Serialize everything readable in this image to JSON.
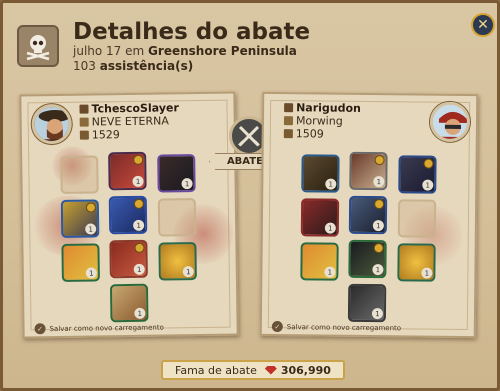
{
  "header": {
    "title": "Detalhes do abate",
    "date": "julho 17",
    "location_prefix": "em",
    "location": "Greenshore Peninsula",
    "assist_count": "103",
    "assist_label": "assistência(s)",
    "icon": "skull-crossbones-icon"
  },
  "close_icon": "close-icon",
  "versus": {
    "label": "ABATEU",
    "icon": "crossed-swords-icon"
  },
  "killer": {
    "name": "TchescoSlayer",
    "guild": "NEVE ETERNA",
    "item_power": "1529",
    "save_label": "Salvar como novo carregamento",
    "equipment": [
      {
        "slot": "head",
        "qty": "1"
      },
      {
        "slot": "bag",
        "qty": "1"
      },
      {
        "slot": "main-hand",
        "qty": "1"
      },
      {
        "slot": "armor",
        "qty": "1"
      },
      {
        "slot": "off-hand",
        "qty": ""
      },
      {
        "slot": "potion",
        "qty": "1"
      },
      {
        "slot": "shoes",
        "qty": "1"
      },
      {
        "slot": "food",
        "qty": "1"
      },
      {
        "slot": "mount",
        "qty": "1"
      }
    ]
  },
  "victim": {
    "name": "Narigudon",
    "guild": "Morwing",
    "item_power": "1509",
    "save_label": "Salvar como novo carregamento",
    "equipment": [
      {
        "slot": "bag",
        "qty": "1"
      },
      {
        "slot": "head",
        "qty": "1"
      },
      {
        "slot": "cape",
        "qty": "1"
      },
      {
        "slot": "main-hand",
        "qty": "1"
      },
      {
        "slot": "armor",
        "qty": "1"
      },
      {
        "slot": "off-hand",
        "qty": ""
      },
      {
        "slot": "potion",
        "qty": "1"
      },
      {
        "slot": "shoes",
        "qty": "1"
      },
      {
        "slot": "food",
        "qty": "1"
      },
      {
        "slot": "mount",
        "qty": "1"
      }
    ]
  },
  "fame": {
    "label": "Fama de abate",
    "value": "306,990"
  },
  "colors": {
    "parchment": "#d9c6a3",
    "accent_gold": "#d6a22e",
    "fame_gem": "#c2302a"
  }
}
